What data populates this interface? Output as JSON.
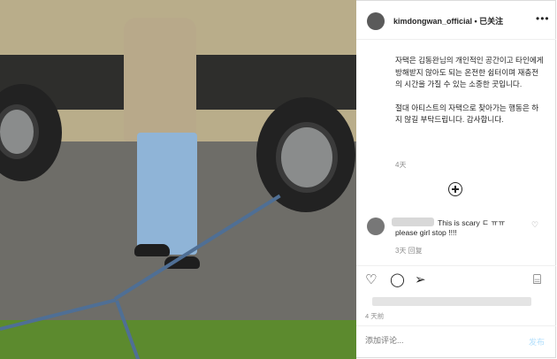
{
  "header": {
    "username": "kimdongwan_official",
    "follow_status": "• 已关注",
    "more_label": "•••"
  },
  "caption": {
    "paragraph1": "자택은 김동완님의 개인적인 공간이고 타인에게 방해받지 않아도 되는 온전한 쉼터이며 재충전의 시간을 가질 수 있는 소중한 곳입니다.",
    "paragraph2": "절대 아티스트의 자택으로 찾아가는 행동은 하지 않길 부탁드립니다. 감사합니다.",
    "time": "4天"
  },
  "comment": {
    "text_line1": "This is scary ㄷ ㅠㅠ",
    "text_line2": "please girl stop !!!!",
    "meta": "3天   回复"
  },
  "actions": {
    "time": "4 天前"
  },
  "comment_box": {
    "placeholder": "添加评论...",
    "post_label": "发布"
  },
  "colors": {
    "text": "#262626",
    "muted": "#8e8e8e",
    "post_disabled": "#b2dffc"
  }
}
